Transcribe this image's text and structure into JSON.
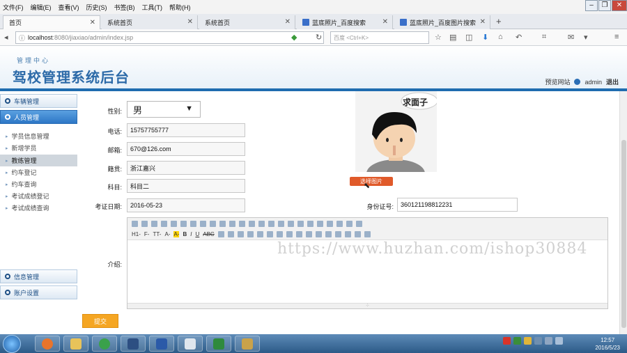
{
  "browser": {
    "menu": [
      "文件(F)",
      "编辑(E)",
      "查看(V)",
      "历史(S)",
      "书签(B)",
      "工具(T)",
      "帮助(H)"
    ],
    "tabs": [
      {
        "label": "首页",
        "active": true
      },
      {
        "label": "系统首页",
        "active": false
      },
      {
        "label": "系统首页",
        "active": false
      },
      {
        "label": "蓝底照片_百度搜索",
        "active": false
      },
      {
        "label": "蓝底照片_百度图片搜索",
        "active": false
      }
    ],
    "url_host": "localhost",
    "url_path": ":8080/jiaxiao/admin/index.jsp",
    "search_placeholder": "百度 <Ctrl+K>"
  },
  "header": {
    "subtitle": "管理中心",
    "title": "驾校管理系统后台",
    "preview_link": "预览网站",
    "user": "admin",
    "logout": "退出"
  },
  "sidebar": {
    "group_vehicle": "车辆管理",
    "group_personnel": "人员管理",
    "items": [
      "学员信息管理",
      "新增学员",
      "教练管理",
      "约车登记",
      "约车查询",
      "考试成绩登记",
      "考试成绩查询"
    ],
    "group_info": "信息管理",
    "group_account": "账户设置"
  },
  "form": {
    "sex_label": "性别:",
    "sex_value": "男",
    "phone_label": "电话:",
    "phone_value": "15757755777",
    "email_label": "邮箱:",
    "email_value": "670@126.com",
    "origin_label": "籍贯:",
    "origin_value": "浙江嘉兴",
    "subject_label": "科目:",
    "subject_value": "科目二",
    "date_label": "考证日期:",
    "date_value": "2016-05-23",
    "id_label": "身份证号:",
    "id_value": "360121198812231",
    "intro_label": "介绍:",
    "upload_btn": "选择图片",
    "photo_caption": "求面子",
    "editor_fonts": [
      "H1-",
      "F-",
      "TT-",
      "A-",
      "A-",
      "B",
      "I",
      "U",
      "ABC"
    ],
    "submit": "提交"
  },
  "watermark": "https://www.huzhan.com/ishop30884",
  "taskbar": {
    "time": "12:57",
    "date": "2016/5/23"
  }
}
